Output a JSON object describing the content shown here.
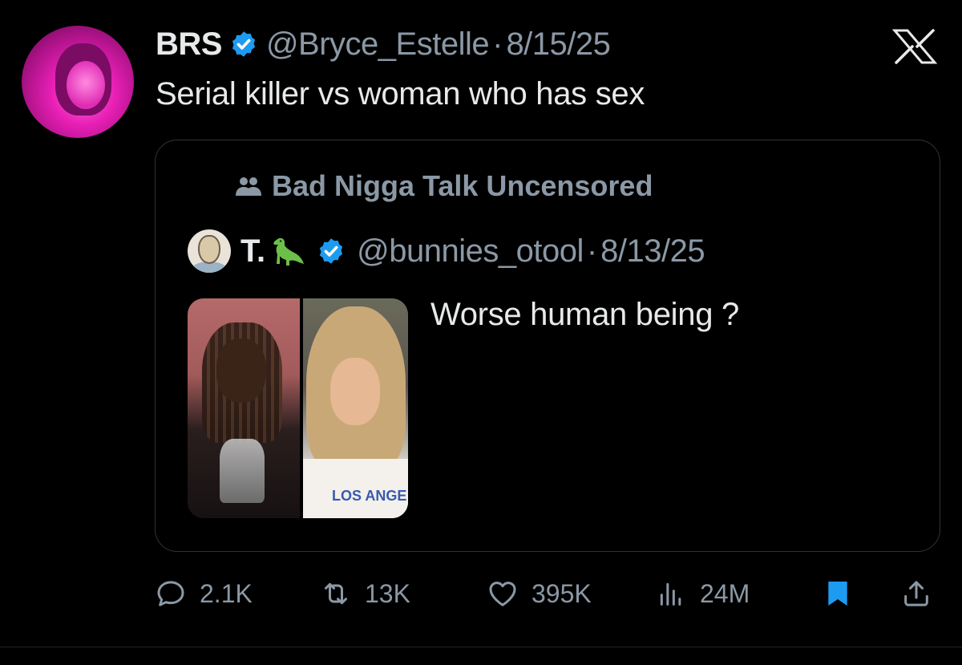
{
  "tweet": {
    "author_name": "BRS",
    "author_handle": "@Bryce_Estelle",
    "separator": "·",
    "date": "8/15/25",
    "text": "Serial killer vs woman who has sex"
  },
  "quoted": {
    "community": "Bad Nigga Talk Uncensored",
    "author_name": "T.",
    "author_handle": "@bunnies_otool",
    "separator": "·",
    "date": "8/13/25",
    "text": "Worse human being ?",
    "media_shirt_text": "LOS ANGE"
  },
  "actions": {
    "replies": "2.1K",
    "reposts": "13K",
    "likes": "395K",
    "views": "24M"
  },
  "colors": {
    "background": "#000000",
    "text": "#e7e9ea",
    "secondary": "#8b98a5",
    "verified": "#1d9bf0",
    "bookmark": "#1d9bf0",
    "border": "#2f3336"
  },
  "icons": [
    "x-logo-icon",
    "verified-badge-icon",
    "community-icon",
    "dinosaur-emoji-icon",
    "reply-icon",
    "repost-icon",
    "like-icon",
    "views-icon",
    "bookmark-icon",
    "share-icon"
  ]
}
